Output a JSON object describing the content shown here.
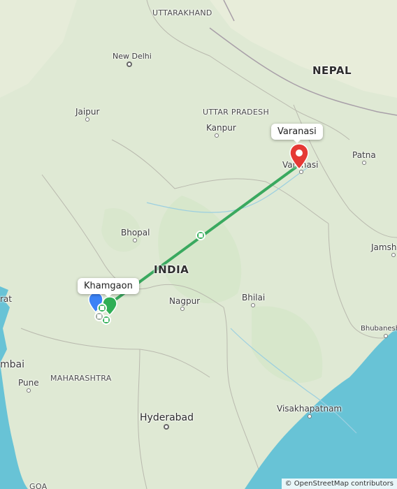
{
  "map": {
    "route_color": "#3aa95f",
    "destination_color": "#e53935",
    "origin_color": "#3b82f6",
    "water_color": "#68c3d6",
    "land_color": "#dfe9d4"
  },
  "regions": {
    "uttarakhand": "UTTARAKHAND",
    "nepal": "NEPAL",
    "uttar_pradesh": "UTTAR PRADESH",
    "india": "INDIA",
    "maharashtra": "MAHARASHTRA"
  },
  "cities": {
    "new_delhi": "New Delhi",
    "jaipur": "Jaipur",
    "kanpur": "Kanpur",
    "patna": "Patna",
    "bhopal": "Bhopal",
    "jamshedpur": "Jamsh",
    "nagpur": "Nagpur",
    "bhilai": "Bhilai",
    "bhubaneswar": "Bhubanesh",
    "surat": "rat",
    "mumbai": "mbai",
    "pune": "Pune",
    "hyderabad": "Hyderabad",
    "visakhapatnam": "Visakhapatnam",
    "varanasi_map": "Varanasi",
    "goa": "GOA"
  },
  "callouts": {
    "destination": "Varanasi",
    "origin": "Khamgaon"
  },
  "route_icons": {
    "mid": "train-icon",
    "stop1": "train-icon",
    "stop2": "train-icon",
    "stop3": "train-icon"
  },
  "attribution": "© OpenStreetMap contributors"
}
